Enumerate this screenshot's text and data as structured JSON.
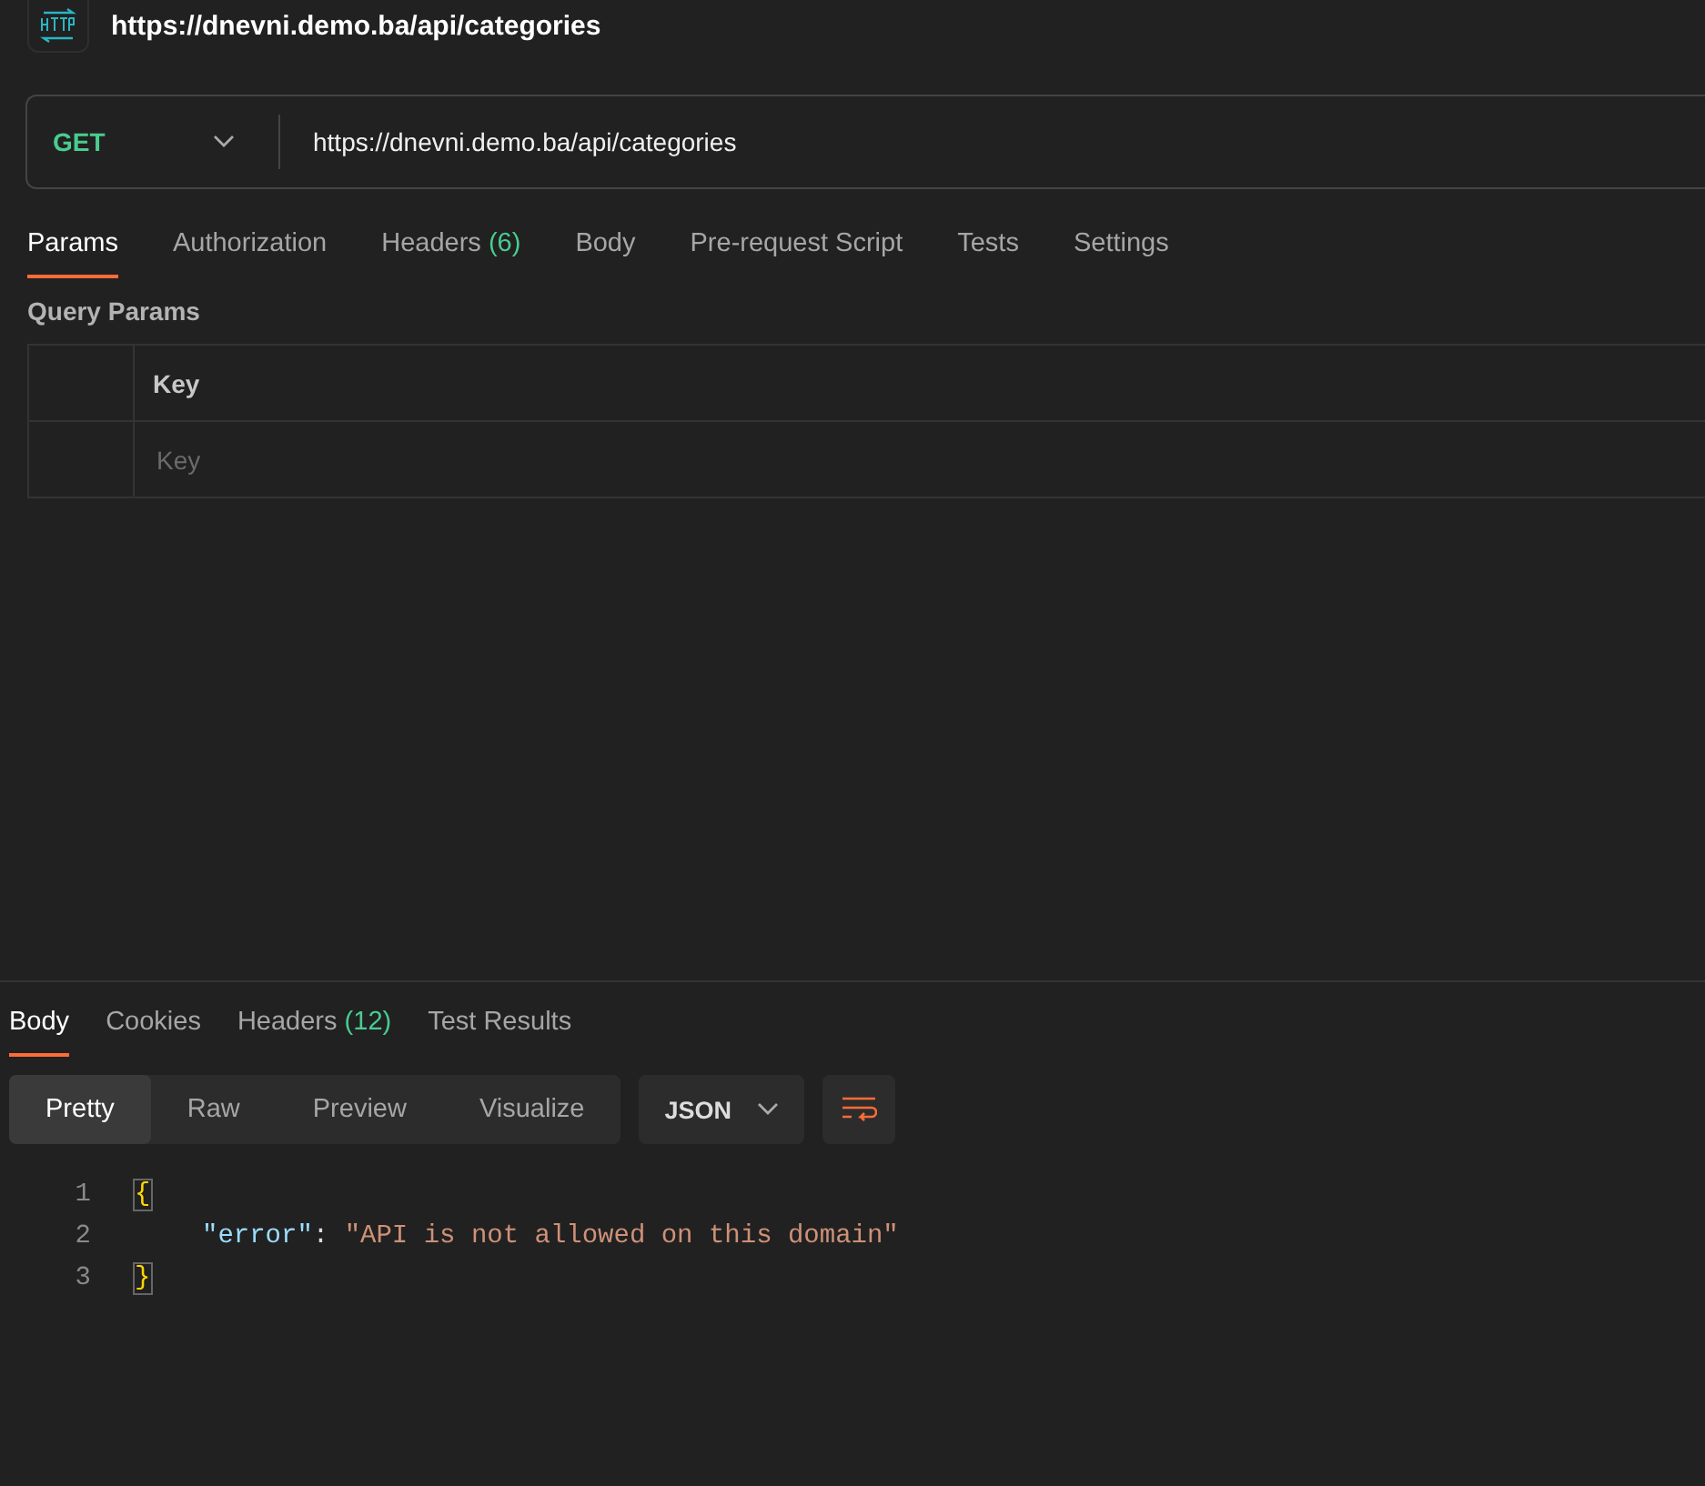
{
  "header": {
    "title": "https://dnevni.demo.ba/api/categories"
  },
  "request": {
    "method": "GET",
    "url": "https://dnevni.demo.ba/api/categories"
  },
  "tabs": [
    {
      "label": "Params",
      "selected": true
    },
    {
      "label": "Authorization",
      "selected": false
    },
    {
      "label": "Headers",
      "count": "(6)",
      "selected": false
    },
    {
      "label": "Body",
      "selected": false
    },
    {
      "label": "Pre-request Script",
      "selected": false
    },
    {
      "label": "Tests",
      "selected": false
    },
    {
      "label": "Settings",
      "selected": false
    }
  ],
  "query_params": {
    "title": "Query Params",
    "columns": [
      "Key"
    ],
    "rows": [
      {
        "key": {
          "placeholder": "Key"
        }
      }
    ]
  },
  "response": {
    "tabs": [
      {
        "label": "Body",
        "selected": true
      },
      {
        "label": "Cookies",
        "selected": false
      },
      {
        "label": "Headers",
        "count": "(12)",
        "selected": false
      },
      {
        "label": "Test Results",
        "selected": false
      }
    ],
    "views": [
      {
        "label": "Pretty",
        "selected": true
      },
      {
        "label": "Raw",
        "selected": false
      },
      {
        "label": "Preview",
        "selected": false
      },
      {
        "label": "Visualize",
        "selected": false
      }
    ],
    "format": "JSON",
    "code": [
      {
        "number": "1",
        "tokens": [
          {
            "kind": "bracket",
            "text": "{"
          }
        ]
      },
      {
        "number": "2",
        "tokens": [
          {
            "kind": "key",
            "text": "\"error\""
          },
          {
            "kind": "punct",
            "text": ": "
          },
          {
            "kind": "string",
            "text": "\"API is not allowed on this domain\""
          }
        ]
      },
      {
        "number": "3",
        "tokens": [
          {
            "kind": "bracket",
            "text": "}"
          }
        ]
      }
    ]
  }
}
